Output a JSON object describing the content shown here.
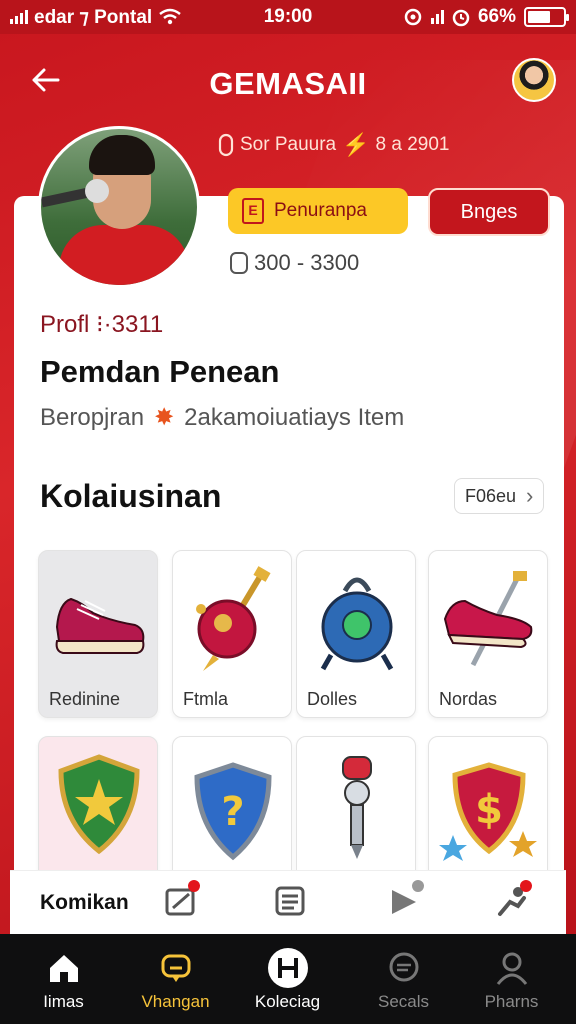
{
  "status_bar": {
    "carrier": "edar ⁊ Pontal",
    "time": "19:00",
    "battery": "66%"
  },
  "header": {
    "title": "GEMASAII",
    "promo_text": "Sor Pauura",
    "promo_value": "8 a 2901"
  },
  "profile": {
    "primary_button": "Penuranpa",
    "secondary_button": "Bnges",
    "range": "300 - 3300",
    "profile_id": "Profl ⁝·3311",
    "name": "Pemdan Penean",
    "subline_left": "Beropjran",
    "subline_right": "2akamoiuatiays Item"
  },
  "collection": {
    "title": "Kolaiusinan",
    "see_more": "F06eu",
    "items": [
      {
        "label": "Redinine"
      },
      {
        "label": "Ftmla"
      },
      {
        "label": "Dolles"
      },
      {
        "label": "Nordas"
      },
      {
        "label": ""
      },
      {
        "label": ""
      },
      {
        "label": ""
      },
      {
        "label": ""
      }
    ]
  },
  "action_strip": {
    "label": "Komikan"
  },
  "nav": [
    {
      "label": "Iimas"
    },
    {
      "label": "Vhangan"
    },
    {
      "label": "Koleciag"
    },
    {
      "label": "Secals"
    },
    {
      "label": "Pharns"
    }
  ],
  "colors": {
    "brand_red": "#c8161e",
    "accent_yellow": "#fcc826",
    "nav_active": "#f6c33a"
  }
}
